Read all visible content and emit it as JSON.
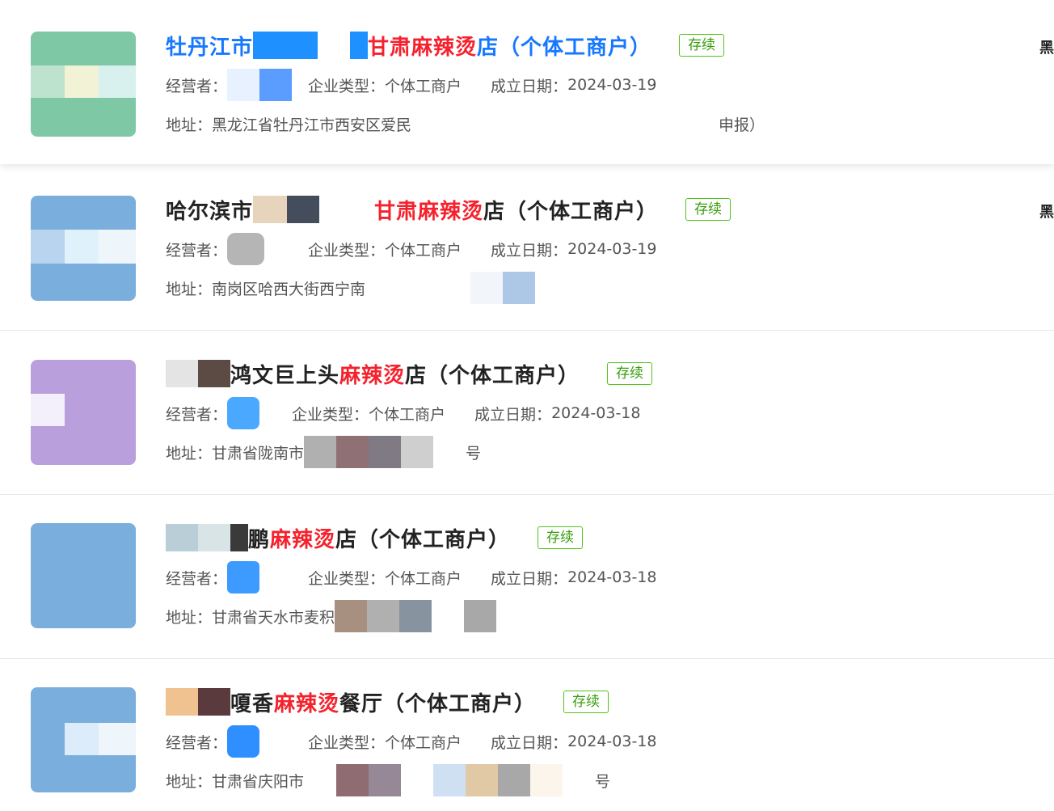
{
  "status_badge_color": "#52c41a",
  "keyword_color": "#f5222d",
  "results": [
    {
      "title_prefix": "牡丹江市",
      "title_mid": "甘肃",
      "keyword": "麻辣烫",
      "title_suffix": "店（个体工商户）",
      "status": "存续",
      "operator_label": "经营者：",
      "type_label": "企业类型：",
      "type_value": "个体工商户",
      "date_label": "成立日期：",
      "date_value": "2024-03-19",
      "address_label": "地址：",
      "address_value": "黑龙江省牡丹江市西安区爱民",
      "address_tail": "申报）",
      "edge_char": "黑"
    },
    {
      "title_prefix": "哈尔滨市",
      "title_mid": "甘肃",
      "keyword": "麻辣烫",
      "title_suffix": "店（个体工商户）",
      "status": "存续",
      "operator_label": "经营者：",
      "type_label": "企业类型：",
      "type_value": "个体工商户",
      "date_label": "成立日期：",
      "date_value": "2024-03-19",
      "address_label": "地址：",
      "address_value": "南岗区哈西大街西宁南",
      "address_tail": "",
      "edge_char": "黑"
    },
    {
      "title_prefix": "",
      "title_mid": "鸿文巨上头",
      "keyword": "麻辣烫",
      "title_suffix": "店（个体工商户）",
      "status": "存续",
      "operator_label": "经营者：",
      "type_label": "企业类型：",
      "type_value": "个体工商户",
      "date_label": "成立日期：",
      "date_value": "2024-03-18",
      "address_label": "地址：",
      "address_value": "甘肃省陇南市",
      "address_tail": "号",
      "edge_char": ""
    },
    {
      "title_prefix": "",
      "title_mid": "鹏",
      "keyword": "麻辣烫",
      "title_suffix": "店（个体工商户）",
      "status": "存续",
      "operator_label": "经营者：",
      "type_label": "企业类型：",
      "type_value": "个体工商户",
      "date_label": "成立日期：",
      "date_value": "2024-03-18",
      "address_label": "地址：",
      "address_value": "甘肃省天水市麦积",
      "address_tail": "",
      "edge_char": ""
    },
    {
      "title_prefix": "",
      "title_mid": "嗄香",
      "keyword": "麻辣烫",
      "title_suffix": "餐厅（个体工商户）",
      "status": "存续",
      "operator_label": "经营者：",
      "type_label": "企业类型：",
      "type_value": "个体工商户",
      "date_label": "成立日期：",
      "date_value": "2024-03-18",
      "address_label": "地址：",
      "address_value": "甘肃省庆阳市",
      "address_tail": "号",
      "edge_char": ""
    }
  ]
}
